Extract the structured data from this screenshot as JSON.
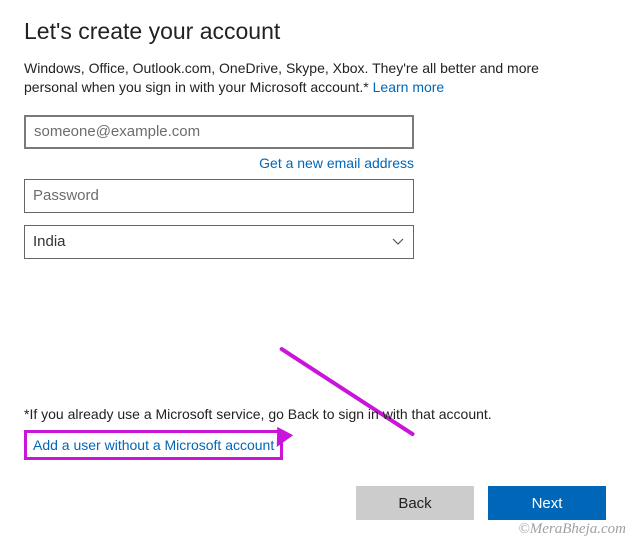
{
  "header": {
    "title": "Let's create your account"
  },
  "intro": {
    "text": "Windows, Office, Outlook.com, OneDrive, Skype, Xbox. They're all better and more personal when you sign in with your Microsoft account.* ",
    "learn_more": "Learn more"
  },
  "form": {
    "email_placeholder": "someone@example.com",
    "email_value": "",
    "new_email_link": "Get a new email address",
    "password_placeholder": "Password",
    "password_value": "",
    "country_selected": "India"
  },
  "footer": {
    "note": "*If you already use a Microsoft service, go Back to sign in with that account.",
    "no_ms_link": "Add a user without a Microsoft account"
  },
  "buttons": {
    "back": "Back",
    "next": "Next"
  },
  "watermark": "©MeraBheja.com"
}
